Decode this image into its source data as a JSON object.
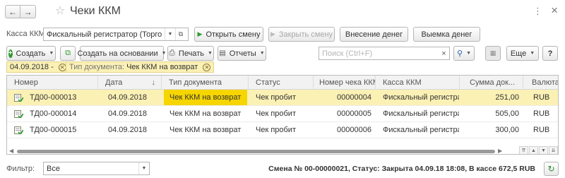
{
  "window": {
    "title": "Чеки ККМ",
    "back_icon": "←",
    "forward_icon": "→",
    "star_icon": "☆",
    "more_icon": "⋮",
    "close_icon": "×"
  },
  "kkm": {
    "label": "Касса ККМ:",
    "value": "Фискальный регистратор (Торговый з",
    "open_shift": "Открыть смену",
    "close_shift": "Закрыть смену",
    "deposit": "Внесение денег",
    "withdraw": "Выемка денег"
  },
  "toolbar": {
    "create": "Создать",
    "create_based": "Создать на основании",
    "print": "Печать",
    "reports": "Отчеты",
    "search_placeholder": "Поиск (Ctrl+F)",
    "more": "Еще",
    "help": "?"
  },
  "filters": {
    "date": "04.09.2018 -",
    "doctype_label": "Тип документа:",
    "doctype_value": "Чек ККМ на возврат"
  },
  "table": {
    "columns": [
      "Номер",
      "Дата",
      "Тип документа",
      "Статус",
      "Номер чека ККМ",
      "Касса ККМ",
      "Сумма док...",
      "Валюта"
    ],
    "sort_icon": "↓",
    "rows": [
      {
        "number": "ТД00-000013",
        "date": "04.09.2018",
        "type": "Чек ККМ на возврат",
        "status": "Чек пробит",
        "check_no": "00000004",
        "kkm": "Фискальный регистрат...",
        "sum": "251,00",
        "currency": "RUB"
      },
      {
        "number": "ТД00-000014",
        "date": "04.09.2018",
        "type": "Чек ККМ на возврат",
        "status": "Чек пробит",
        "check_no": "00000005",
        "kkm": "Фискальный регистрат...",
        "sum": "505,00",
        "currency": "RUB"
      },
      {
        "number": "ТД00-000015",
        "date": "04.09.2018",
        "type": "Чек ККМ на возврат",
        "status": "Чек пробит",
        "check_no": "00000006",
        "kkm": "Фискальный регистрат...",
        "sum": "300,00",
        "currency": "RUB"
      }
    ]
  },
  "footer": {
    "filter_label": "Фильтр:",
    "filter_value": "Все",
    "status_text": "Смена № 00-00000021, Статус: Закрыта 04.09.18 18:08, В кассе 672,5 RUB"
  },
  "colors": {
    "selected_row": "#fbf1b5",
    "highlight_cell": "#f6d500",
    "play_green": "#2e9b2e"
  }
}
